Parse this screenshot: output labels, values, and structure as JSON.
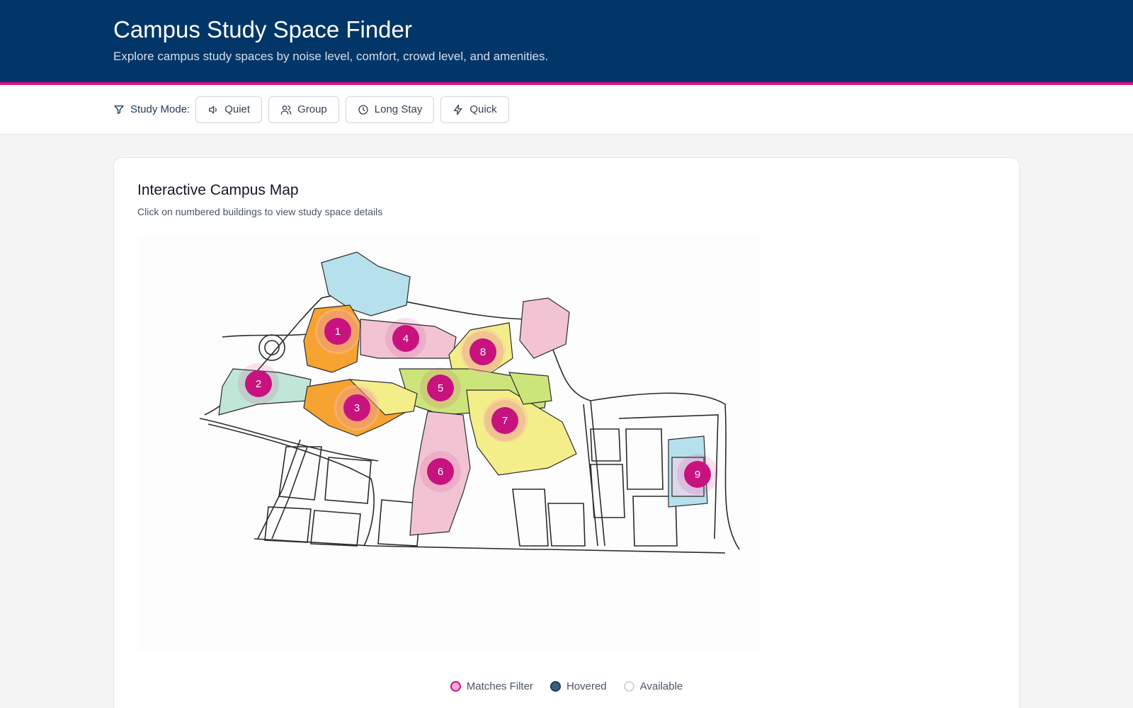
{
  "header": {
    "title": "Campus Study Space Finder",
    "subtitle": "Explore campus study spaces by noise level, comfort, crowd level, and amenities."
  },
  "filter": {
    "label": "Study Mode:",
    "icon": "filter-icon",
    "modes": [
      {
        "label": "Quiet",
        "icon": "speaker-icon"
      },
      {
        "label": "Group",
        "icon": "users-icon"
      },
      {
        "label": "Long Stay",
        "icon": "clock-icon"
      },
      {
        "label": "Quick",
        "icon": "lightning-icon"
      }
    ]
  },
  "map_card": {
    "title": "Interactive Campus Map",
    "subtitle": "Click on numbered buildings to view study space details",
    "markers": [
      "1",
      "2",
      "3",
      "4",
      "5",
      "6",
      "7",
      "8",
      "9"
    ]
  },
  "legend": {
    "items": [
      {
        "label": "Matches Filter",
        "fill": "#f9a8d4",
        "border": "#c8127e"
      },
      {
        "label": "Hovered",
        "fill": "#3a5f85",
        "border": "#1e3a5f"
      },
      {
        "label": "Available",
        "fill": "#ffffff",
        "border": "#d1d5db"
      }
    ]
  },
  "colors": {
    "header_bg": "#023668",
    "accent": "#d6107f",
    "marker": "#c8127e"
  }
}
